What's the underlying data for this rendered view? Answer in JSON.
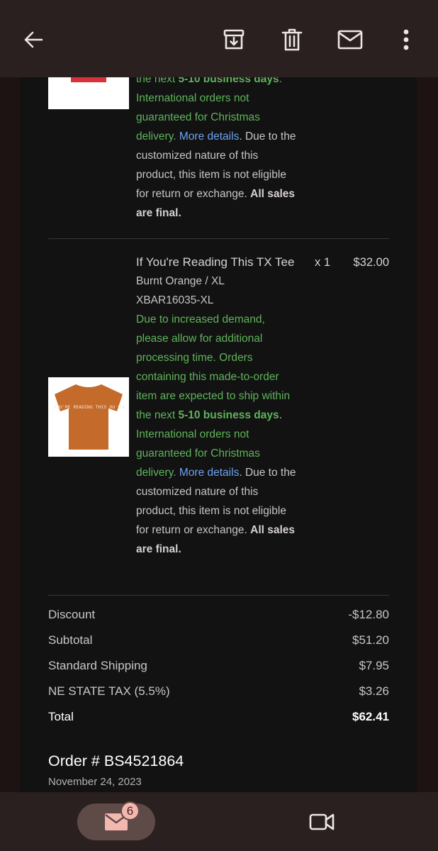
{
  "app": {
    "top_actions": [
      "back-icon",
      "archive-icon",
      "delete-icon",
      "mark-unread-icon",
      "more-options-icon"
    ]
  },
  "item1": {
    "text_prefix": "the next ",
    "business_days": "5-10 business days",
    "text_suffix": ".",
    "international_note": "International orders not guaranteed for Christmas delivery.",
    "more_details": "More details",
    "customized_note": ". Due to the customized nature of this product, this item is not eligible for return or exchange.",
    "all_sales_final": "All sales are final."
  },
  "item2": {
    "title": "If You're Reading This TX Tee",
    "qty": "x 1",
    "price": "$32.00",
    "variant": "Burnt Orange / XL",
    "sku": "XBAR16035-XL",
    "shirt_text": "IF YOU'RE READING THIS OU SUCKS",
    "demand_note": "Due to increased demand, please allow for additional processing time. Orders containing this made-to-order item are expected to ship within the next ",
    "business_days": "5-10 business days",
    "text_suffix": ".",
    "international_note": "International orders not guaranteed for Christmas delivery.",
    "more_details": "More details",
    "customized_note": ". Due to the customized nature of this product, this item is not eligible for return or exchange.",
    "all_sales_final": "All sales are final."
  },
  "totals": {
    "discount_label": "Discount",
    "discount_value": "-$12.80",
    "subtotal_label": "Subtotal",
    "subtotal_value": "$51.20",
    "shipping_label": "Standard Shipping",
    "shipping_value": "$7.95",
    "tax_label": "NE STATE TAX (5.5%)",
    "tax_value": "$3.26",
    "total_label": "Total",
    "total_value": "$62.41"
  },
  "order": {
    "number": "Order # BS4521864",
    "date": "November 24, 2023"
  },
  "bottom_nav": {
    "mail_badge": "6"
  },
  "colors": {
    "accent_green": "#5fb35a",
    "link_blue": "#6ea2f0",
    "badge_pink": "#f2b8b0",
    "shirt_red": "#d9313a",
    "shirt_orange": "#c46a2a"
  }
}
